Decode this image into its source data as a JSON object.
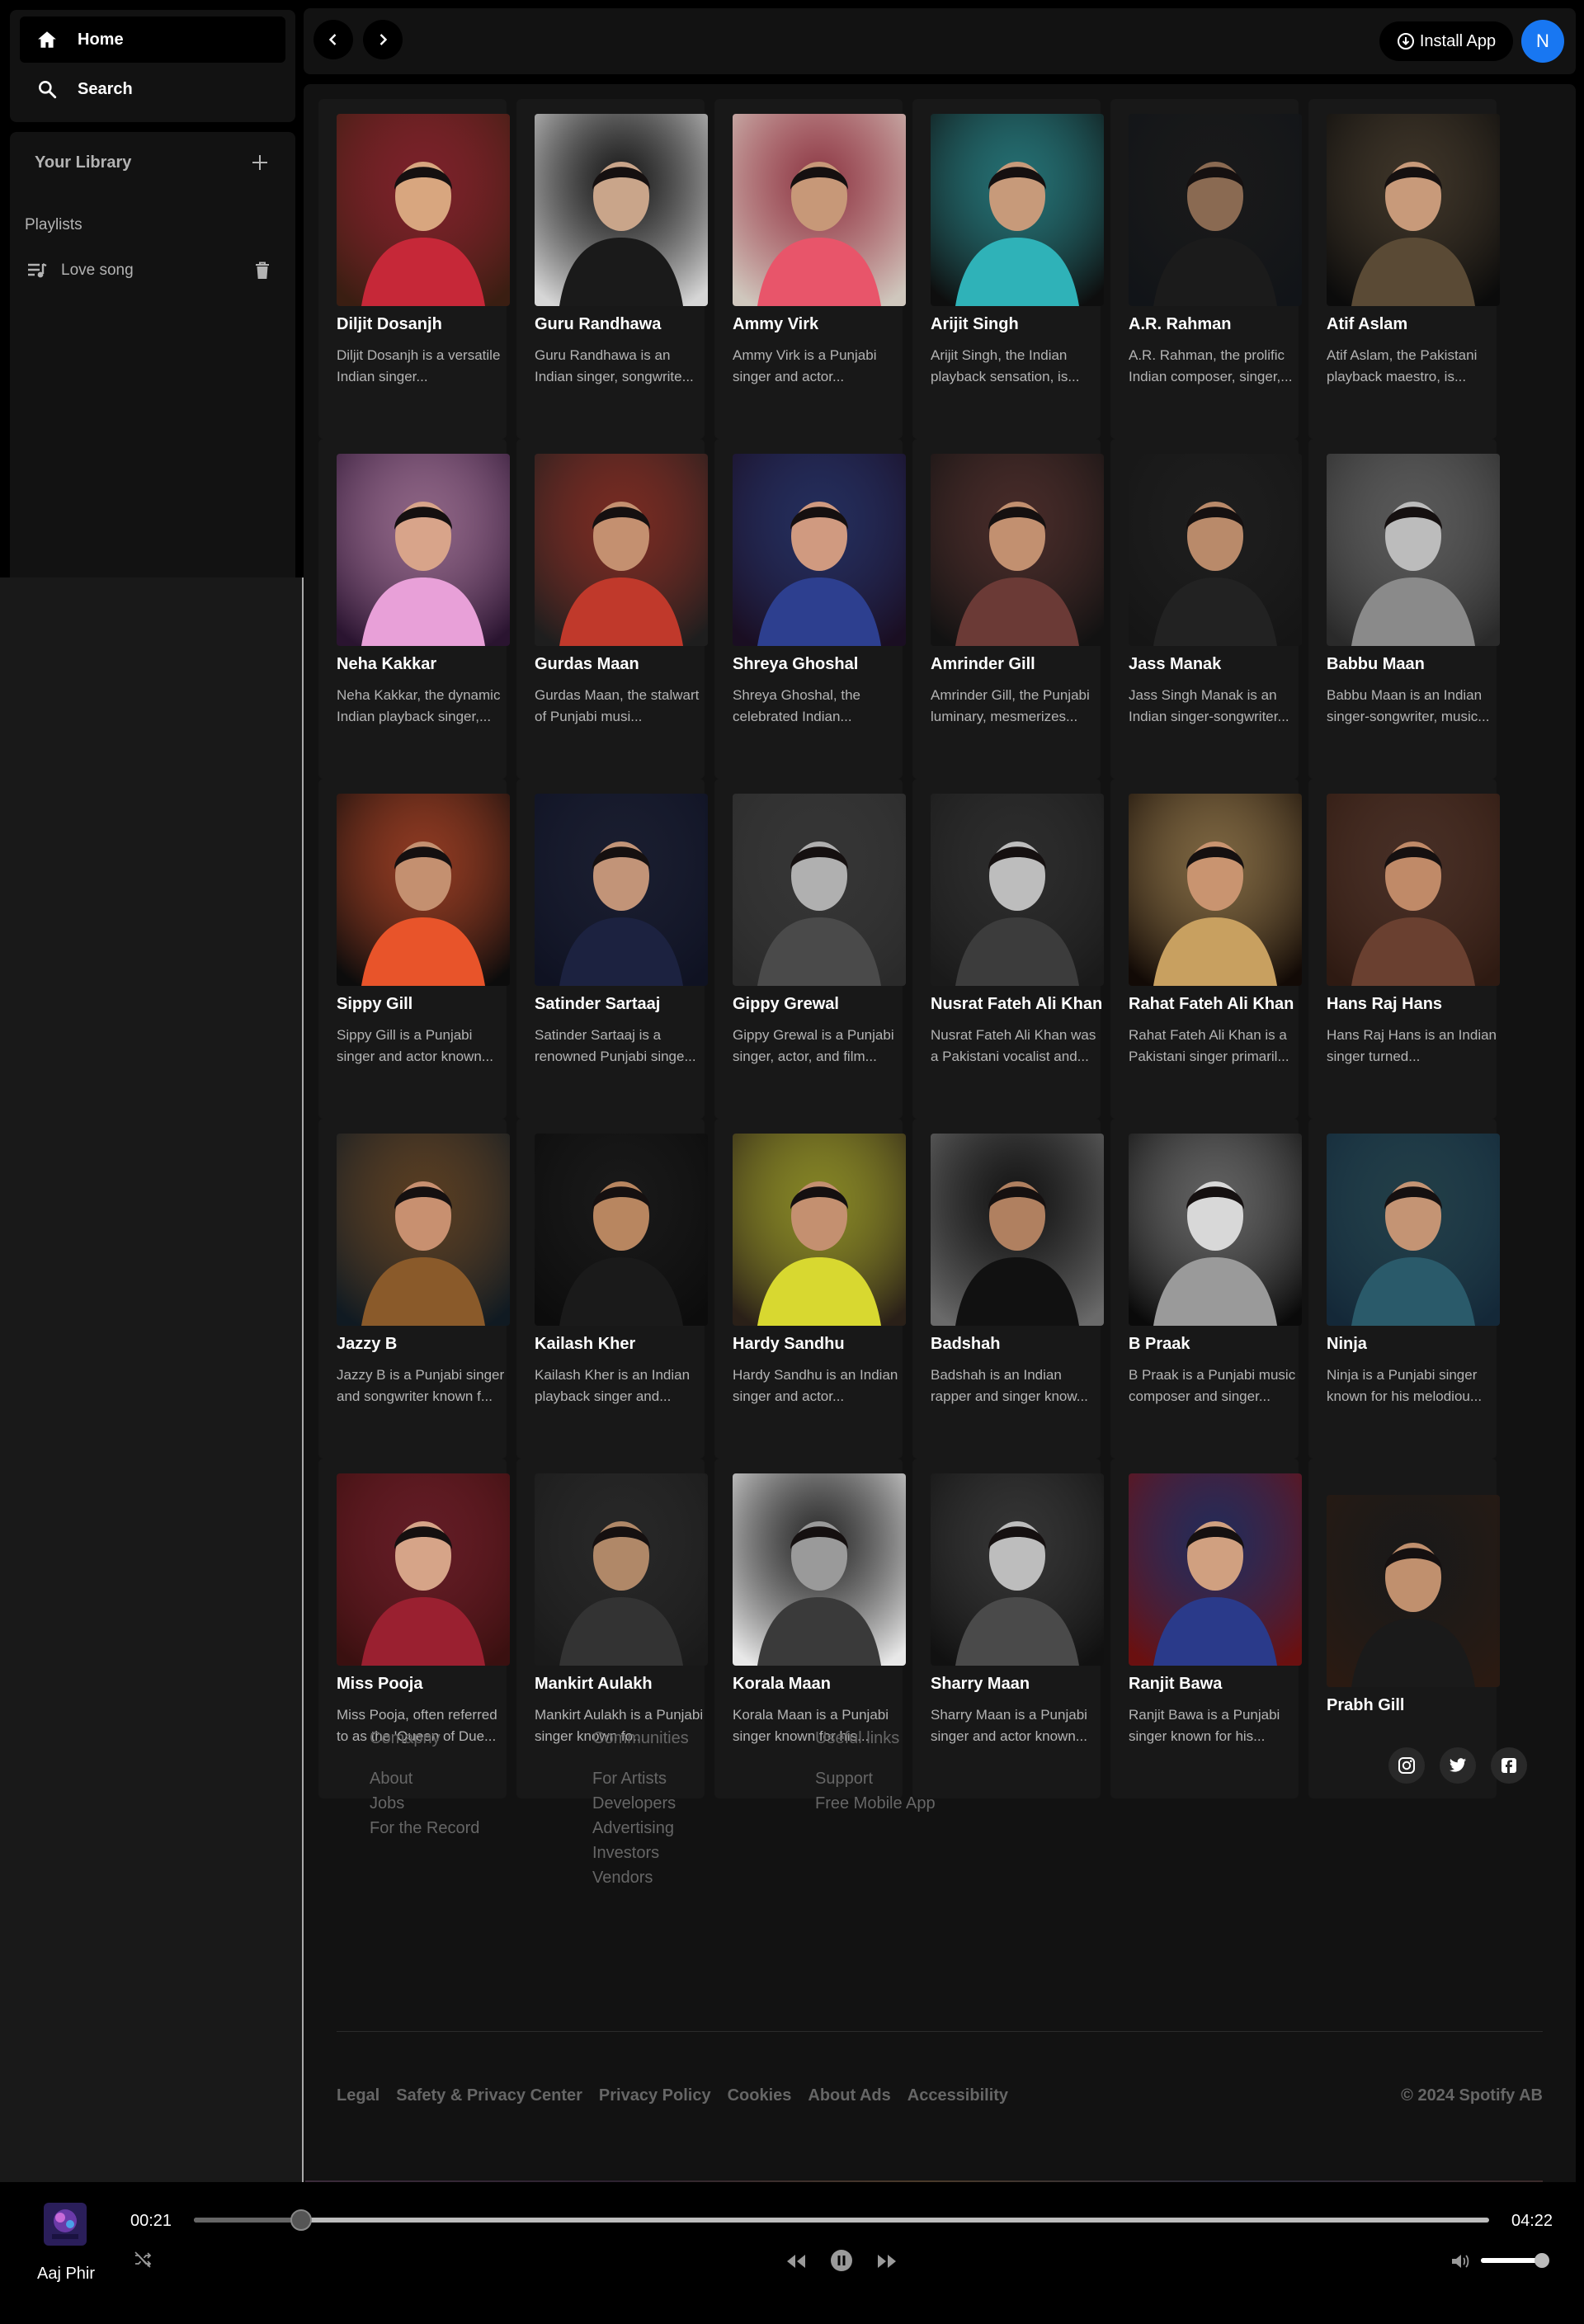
{
  "nav": {
    "home_label": "Home",
    "search_label": "Search"
  },
  "library": {
    "title": "Your Library",
    "section_label": "Playlists",
    "playlists": [
      {
        "name": "Love song"
      }
    ]
  },
  "topbar": {
    "install_label": "Install App",
    "avatar_letter": "N"
  },
  "artists": [
    {
      "name": "Diljit Dosanjh",
      "desc": "Diljit Dosanjh is a versatile Indian singer...",
      "tone": [
        "#3a1e12",
        "#c62838",
        "#d8a67f"
      ]
    },
    {
      "name": "Guru Randhawa",
      "desc": "Guru Randhawa is an Indian singer, songwrite...",
      "tone": [
        "#d6d6d6",
        "#1a1a1a",
        "#c9a58a"
      ]
    },
    {
      "name": "Ammy Virk",
      "desc": "Ammy Virk is a Punjabi singer and actor...",
      "tone": [
        "#cfc7bd",
        "#e8556a",
        "#c79878"
      ]
    },
    {
      "name": "Arijit Singh",
      "desc": "Arijit Singh, the Indian playback sensation, is...",
      "tone": [
        "#0e0e0e",
        "#2fb2b8",
        "#c79a7a"
      ]
    },
    {
      "name": "A.R. Rahman",
      "desc": "A.R. Rahman, the prolific Indian composer, singer,...",
      "tone": [
        "#111418",
        "#1b1b1b",
        "#8a6a52"
      ]
    },
    {
      "name": "Atif Aslam",
      "desc": "Atif Aslam, the Pakistani playback maestro, is...",
      "tone": [
        "#0b0b0b",
        "#5a4a35",
        "#c89a7a"
      ]
    },
    {
      "name": "Neha Kakkar",
      "desc": "Neha Kakkar, the dynamic Indian playback singer,...",
      "tone": [
        "#2a1430",
        "#e8a0d8",
        "#d8a48a"
      ]
    },
    {
      "name": "Gurdas Maan",
      "desc": "Gurdas Maan, the stalwart of Punjabi musi...",
      "tone": [
        "#1e1e1e",
        "#c0392b",
        "#c49070"
      ]
    },
    {
      "name": "Shreya Ghoshal",
      "desc": "Shreya Ghoshal, the celebrated Indian...",
      "tone": [
        "#1a0e22",
        "#2d3f8f",
        "#d09a80"
      ]
    },
    {
      "name": "Amrinder Gill",
      "desc": "Amrinder Gill, the Punjabi luminary, mesmerizes...",
      "tone": [
        "#121212",
        "#6b3a36",
        "#c29070"
      ]
    },
    {
      "name": "Jass Manak",
      "desc": "Jass Singh Manak is an Indian singer-songwriter...",
      "tone": [
        "#151515",
        "#222222",
        "#b98a6a"
      ]
    },
    {
      "name": "Babbu Maan",
      "desc": "Babbu Maan is an Indian singer-songwriter, music...",
      "tone": [
        "#2a2a2a",
        "#8a8a8a",
        "#bcbcbc"
      ]
    },
    {
      "name": "Sippy Gill",
      "desc": "Sippy Gill is a Punjabi singer and actor known...",
      "tone": [
        "#0c0c0c",
        "#e8542a",
        "#c49070"
      ]
    },
    {
      "name": "Satinder Sartaaj",
      "desc": "Satinder Sartaaj is a renowned Punjabi singe...",
      "tone": [
        "#0f1222",
        "#1c2240",
        "#c29478"
      ]
    },
    {
      "name": "Gippy Grewal",
      "desc": "Gippy Grewal is a Punjabi singer, actor, and film...",
      "tone": [
        "#2a2a2a",
        "#4a4a4a",
        "#b0b0b0"
      ]
    },
    {
      "name": "Nusrat Fateh Ali Khan",
      "desc": "Nusrat Fateh Ali Khan was a Pakistani vocalist and...",
      "tone": [
        "#1a1a1a",
        "#3c3c3c",
        "#bdbdbd"
      ]
    },
    {
      "name": "Rahat Fateh Ali Khan",
      "desc": "Rahat Fateh Ali Khan is a Pakistani singer primaril...",
      "tone": [
        "#120a06",
        "#c8a060",
        "#c99470"
      ]
    },
    {
      "name": "Hans Raj Hans",
      "desc": "Hans Raj Hans is an Indian singer turned...",
      "tone": [
        "#2e1a12",
        "#6a4030",
        "#c08a68"
      ]
    },
    {
      "name": "Jazzy B",
      "desc": "Jazzy B is a Punjabi singer and songwriter known f...",
      "tone": [
        "#101a22",
        "#8a5a2a",
        "#c89070"
      ]
    },
    {
      "name": "Kailash Kher",
      "desc": "Kailash Kher is an Indian playback singer and...",
      "tone": [
        "#0c0c0c",
        "#1a1a1a",
        "#b88660"
      ]
    },
    {
      "name": "Hardy Sandhu",
      "desc": "Hardy Sandhu is an Indian singer and actor...",
      "tone": [
        "#2a2018",
        "#d8d830",
        "#c49070"
      ]
    },
    {
      "name": "Badshah",
      "desc": "Badshah is an Indian rapper and singer know...",
      "tone": [
        "#6a6a6a",
        "#111111",
        "#b08060"
      ]
    },
    {
      "name": "B Praak",
      "desc": "B Praak is a Punjabi music composer and singer...",
      "tone": [
        "#0a0a0a",
        "#9a9a9a",
        "#d8d8d8"
      ]
    },
    {
      "name": "Ninja",
      "desc": "Ninja is a Punjabi singer known for his melodiou...",
      "tone": [
        "#142838",
        "#2a5a6a",
        "#c49474"
      ]
    },
    {
      "name": "Miss Pooja",
      "desc": "Miss Pooja, often referred to as the 'Queen of Due...",
      "tone": [
        "#3a1010",
        "#9a2030",
        "#d6a488"
      ]
    },
    {
      "name": "Mankirt Aulakh",
      "desc": "Mankirt Aulakh is a Punjabi singer known fo...",
      "tone": [
        "#1a1a1a",
        "#333333",
        "#b08868"
      ]
    },
    {
      "name": "Korala Maan",
      "desc": "Korala Maan is a Punjabi singer known for his...",
      "tone": [
        "#e8e8e8",
        "#3a3a3a",
        "#9a9a9a"
      ]
    },
    {
      "name": "Sharry Maan",
      "desc": "Sharry Maan is a Punjabi singer and actor known...",
      "tone": [
        "#111111",
        "#4a4a4a",
        "#bdbdbd"
      ]
    },
    {
      "name": "Ranjit Bawa",
      "desc": "Ranjit Bawa is a Punjabi singer known for his...",
      "tone": [
        "#6a1010",
        "#2a3a8a",
        "#d0a080"
      ]
    },
    {
      "name": "Prabh Gill",
      "desc": "",
      "tone": [
        "#2a1a12",
        "#1a1a1a",
        "#c0906e"
      ]
    }
  ],
  "footer": {
    "columns": [
      {
        "heading": "Comapny",
        "links": [
          "About",
          "Jobs",
          "For the Record"
        ]
      },
      {
        "heading": "Communities",
        "links": [
          "For Artists",
          "Developers",
          "Advertising",
          "Investors",
          "Vendors"
        ]
      },
      {
        "heading": "Useful links",
        "links": [
          "Support",
          "Free Mobile App"
        ]
      }
    ],
    "socials": [
      "instagram-icon",
      "twitter-icon",
      "facebook-icon"
    ],
    "legal": [
      "Legal",
      "Safety & Privacy Center",
      "Privacy Policy",
      "Cookies",
      "About Ads",
      "Accessibility"
    ],
    "copyright": "© 2024 Spotify AB"
  },
  "player": {
    "track_title": "Aaj Phir",
    "current_time": "00:21",
    "total_time": "04:22",
    "progress": 0.083,
    "volume": 0.9
  }
}
